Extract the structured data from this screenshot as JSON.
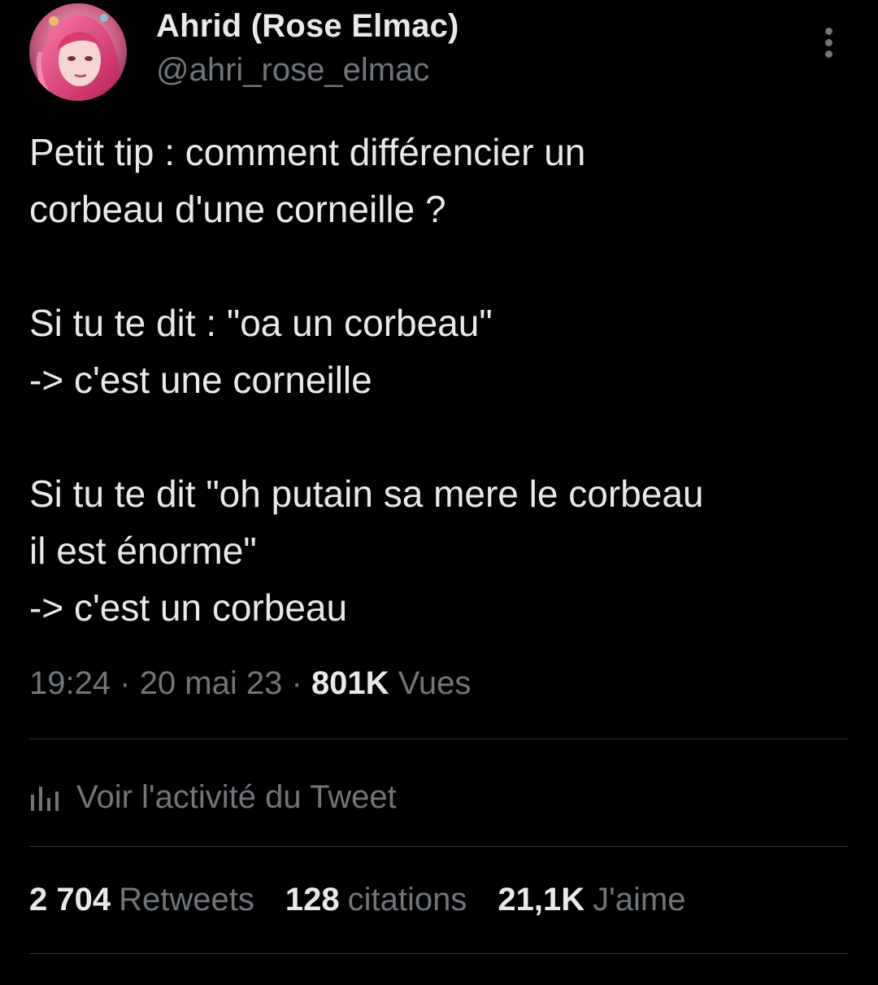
{
  "author": {
    "display_name": "Ahrid (Rose Elmac)",
    "handle": "@ahri_rose_elmac"
  },
  "icons": {
    "avatar": "avatar-image",
    "more": "more-vertical-icon",
    "activity": "bar-chart-icon"
  },
  "tweet": {
    "paragraphs": [
      [
        "Petit tip : comment différencier un",
        "corbeau d'une corneille ?"
      ],
      [
        "Si tu te dit : \"oa un corbeau\"",
        "-> c'est une corneille"
      ],
      [
        "Si tu te dit \"oh putain sa mere le corbeau",
        "il est énorme\"",
        "-> c'est un corbeau"
      ]
    ]
  },
  "meta": {
    "time": "19:24",
    "separator": "·",
    "date": "20 mai 23",
    "views_count": "801K",
    "views_label": "Vues"
  },
  "activity_link": "Voir l'activité du Tweet",
  "stats": {
    "retweets_count": "2 704",
    "retweets_label": "Retweets",
    "quotes_count": "128",
    "quotes_label": "citations",
    "likes_count": "21,1K",
    "likes_label": "J'aime"
  },
  "colors": {
    "background": "#000000",
    "primary_text": "#e7e9ea",
    "secondary_text": "#71767b",
    "divider": "#2f3336"
  }
}
